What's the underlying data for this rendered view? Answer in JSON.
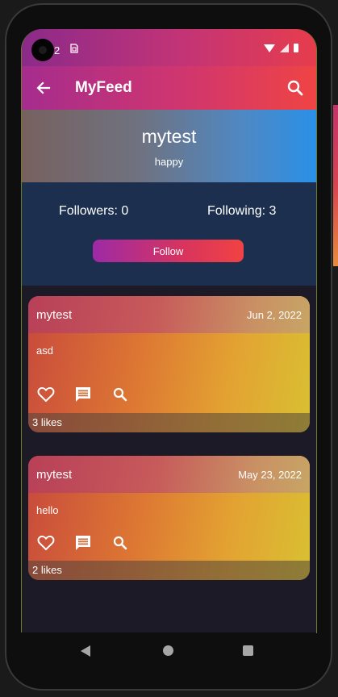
{
  "status_bar": {
    "time": "2",
    "sim_icon": "sim-card-icon"
  },
  "app_bar": {
    "title": "MyFeed",
    "back_icon": "arrow-back-icon",
    "search_icon": "search-icon"
  },
  "profile": {
    "name": "mytest",
    "status": "happy"
  },
  "stats": {
    "followers": "Followers: 0",
    "following": "Following: 3",
    "follow_label": "Follow"
  },
  "posts": [
    {
      "author": "mytest",
      "date": "Jun 2, 2022",
      "text": "asd",
      "likes": "3 likes"
    },
    {
      "author": "mytest",
      "date": "May 23, 2022",
      "text": "hello",
      "likes": "2 likes"
    }
  ],
  "colors": {
    "app_bar_start": "#a52c8e",
    "app_bar_end": "#ef4444",
    "stats_bg": "#1d2f4e",
    "feed_bg": "#1b1a26"
  }
}
